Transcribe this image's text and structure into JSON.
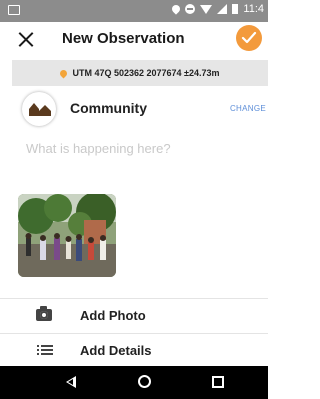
{
  "status_bar": {
    "time": "11:4",
    "icons": [
      "screen-icon",
      "location-icon",
      "do-not-disturb-icon",
      "wifi-icon",
      "signal-icon",
      "battery-icon"
    ]
  },
  "app_bar": {
    "title": "New Observation",
    "close_icon": "close-icon",
    "confirm_icon": "check-icon",
    "accent_color": "#f39a3c"
  },
  "gps": {
    "coordinates": "UTM 47Q 502362 2077674 ±24.73m",
    "icon": "location-pin-icon"
  },
  "category": {
    "label": "Community",
    "change_label": "CHANGE",
    "icon": "community-houses-icon"
  },
  "description": {
    "placeholder": "What is happening here?",
    "value": ""
  },
  "photos": [
    {
      "alt": "outdoor community gathering"
    }
  ],
  "actions": [
    {
      "label": "Add Photo",
      "icon": "camera-icon"
    },
    {
      "label": "Add Details",
      "icon": "list-icon"
    }
  ],
  "nav_bar": {
    "icons": [
      "back-icon",
      "home-icon",
      "recent-apps-icon"
    ]
  }
}
